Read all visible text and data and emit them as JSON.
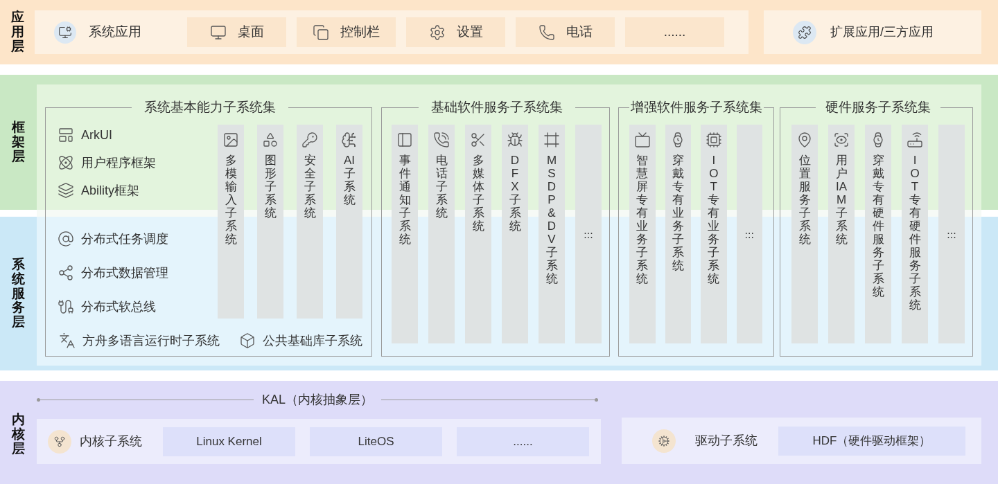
{
  "application_layer": {
    "label": "应用层",
    "system_apps": {
      "title": "系统应用",
      "items": [
        "桌面",
        "控制栏",
        "设置",
        "电话",
        "......"
      ]
    },
    "extension": "扩展应用/三方应用"
  },
  "framework_layer": {
    "label": "框架层"
  },
  "service_layer": {
    "label": "系统服务层"
  },
  "subsystem_sets": [
    {
      "title": "系统基本能力子系统集",
      "framework_items": [
        "ArkUI",
        "用户程序框架",
        "Ability框架"
      ],
      "service_items": [
        "分布式任务调度",
        "分布式数据管理",
        "分布式软总线"
      ],
      "bottom_items": [
        "方舟多语言运行时子系统",
        "公共基础库子系统"
      ],
      "columns": [
        {
          "kind": "subsystem",
          "label": "多模输入子系统"
        },
        {
          "kind": "subsystem",
          "label": "图形子系统"
        },
        {
          "kind": "subsystem",
          "label": "安全子系统"
        },
        {
          "kind": "subsystem",
          "label": "AI子系统"
        }
      ]
    },
    {
      "title": "基础软件服务子系统集",
      "columns": [
        {
          "kind": "subsystem",
          "label": "事件通知子系统"
        },
        {
          "kind": "subsystem",
          "label": "电话子系统"
        },
        {
          "kind": "subsystem",
          "label": "多媒体子系统"
        },
        {
          "kind": "subsystem",
          "label": "DFX子系统"
        },
        {
          "kind": "subsystem",
          "label": "MSDP&DV子系统"
        },
        {
          "kind": "more",
          "label": "......"
        }
      ]
    },
    {
      "title": "增强软件服务子系统集",
      "columns": [
        {
          "kind": "subsystem",
          "label": "智慧屏专有业务子系统"
        },
        {
          "kind": "subsystem",
          "label": "穿戴专有业务子系统"
        },
        {
          "kind": "subsystem",
          "label": "IOT专有业务子系统"
        },
        {
          "kind": "more",
          "label": "......"
        }
      ]
    },
    {
      "title": "硬件服务子系统集",
      "columns": [
        {
          "kind": "subsystem",
          "label": "位置服务子系统"
        },
        {
          "kind": "subsystem",
          "label": "用户IAM子系统"
        },
        {
          "kind": "subsystem",
          "label": "穿戴专有硬件服务子系统"
        },
        {
          "kind": "subsystem",
          "label": "IOT专有硬件服务子系统"
        },
        {
          "kind": "more",
          "label": "......"
        }
      ]
    }
  ],
  "kernel_layer": {
    "label": "内核层",
    "kal": "KAL（内核抽象层）",
    "kernel": {
      "title": "内核子系统",
      "items": [
        "Linux Kernel",
        "LiteOS",
        "......"
      ]
    },
    "driver": {
      "title": "驱动子系统",
      "items": [
        "HDF（硬件驱动框架）"
      ]
    }
  }
}
